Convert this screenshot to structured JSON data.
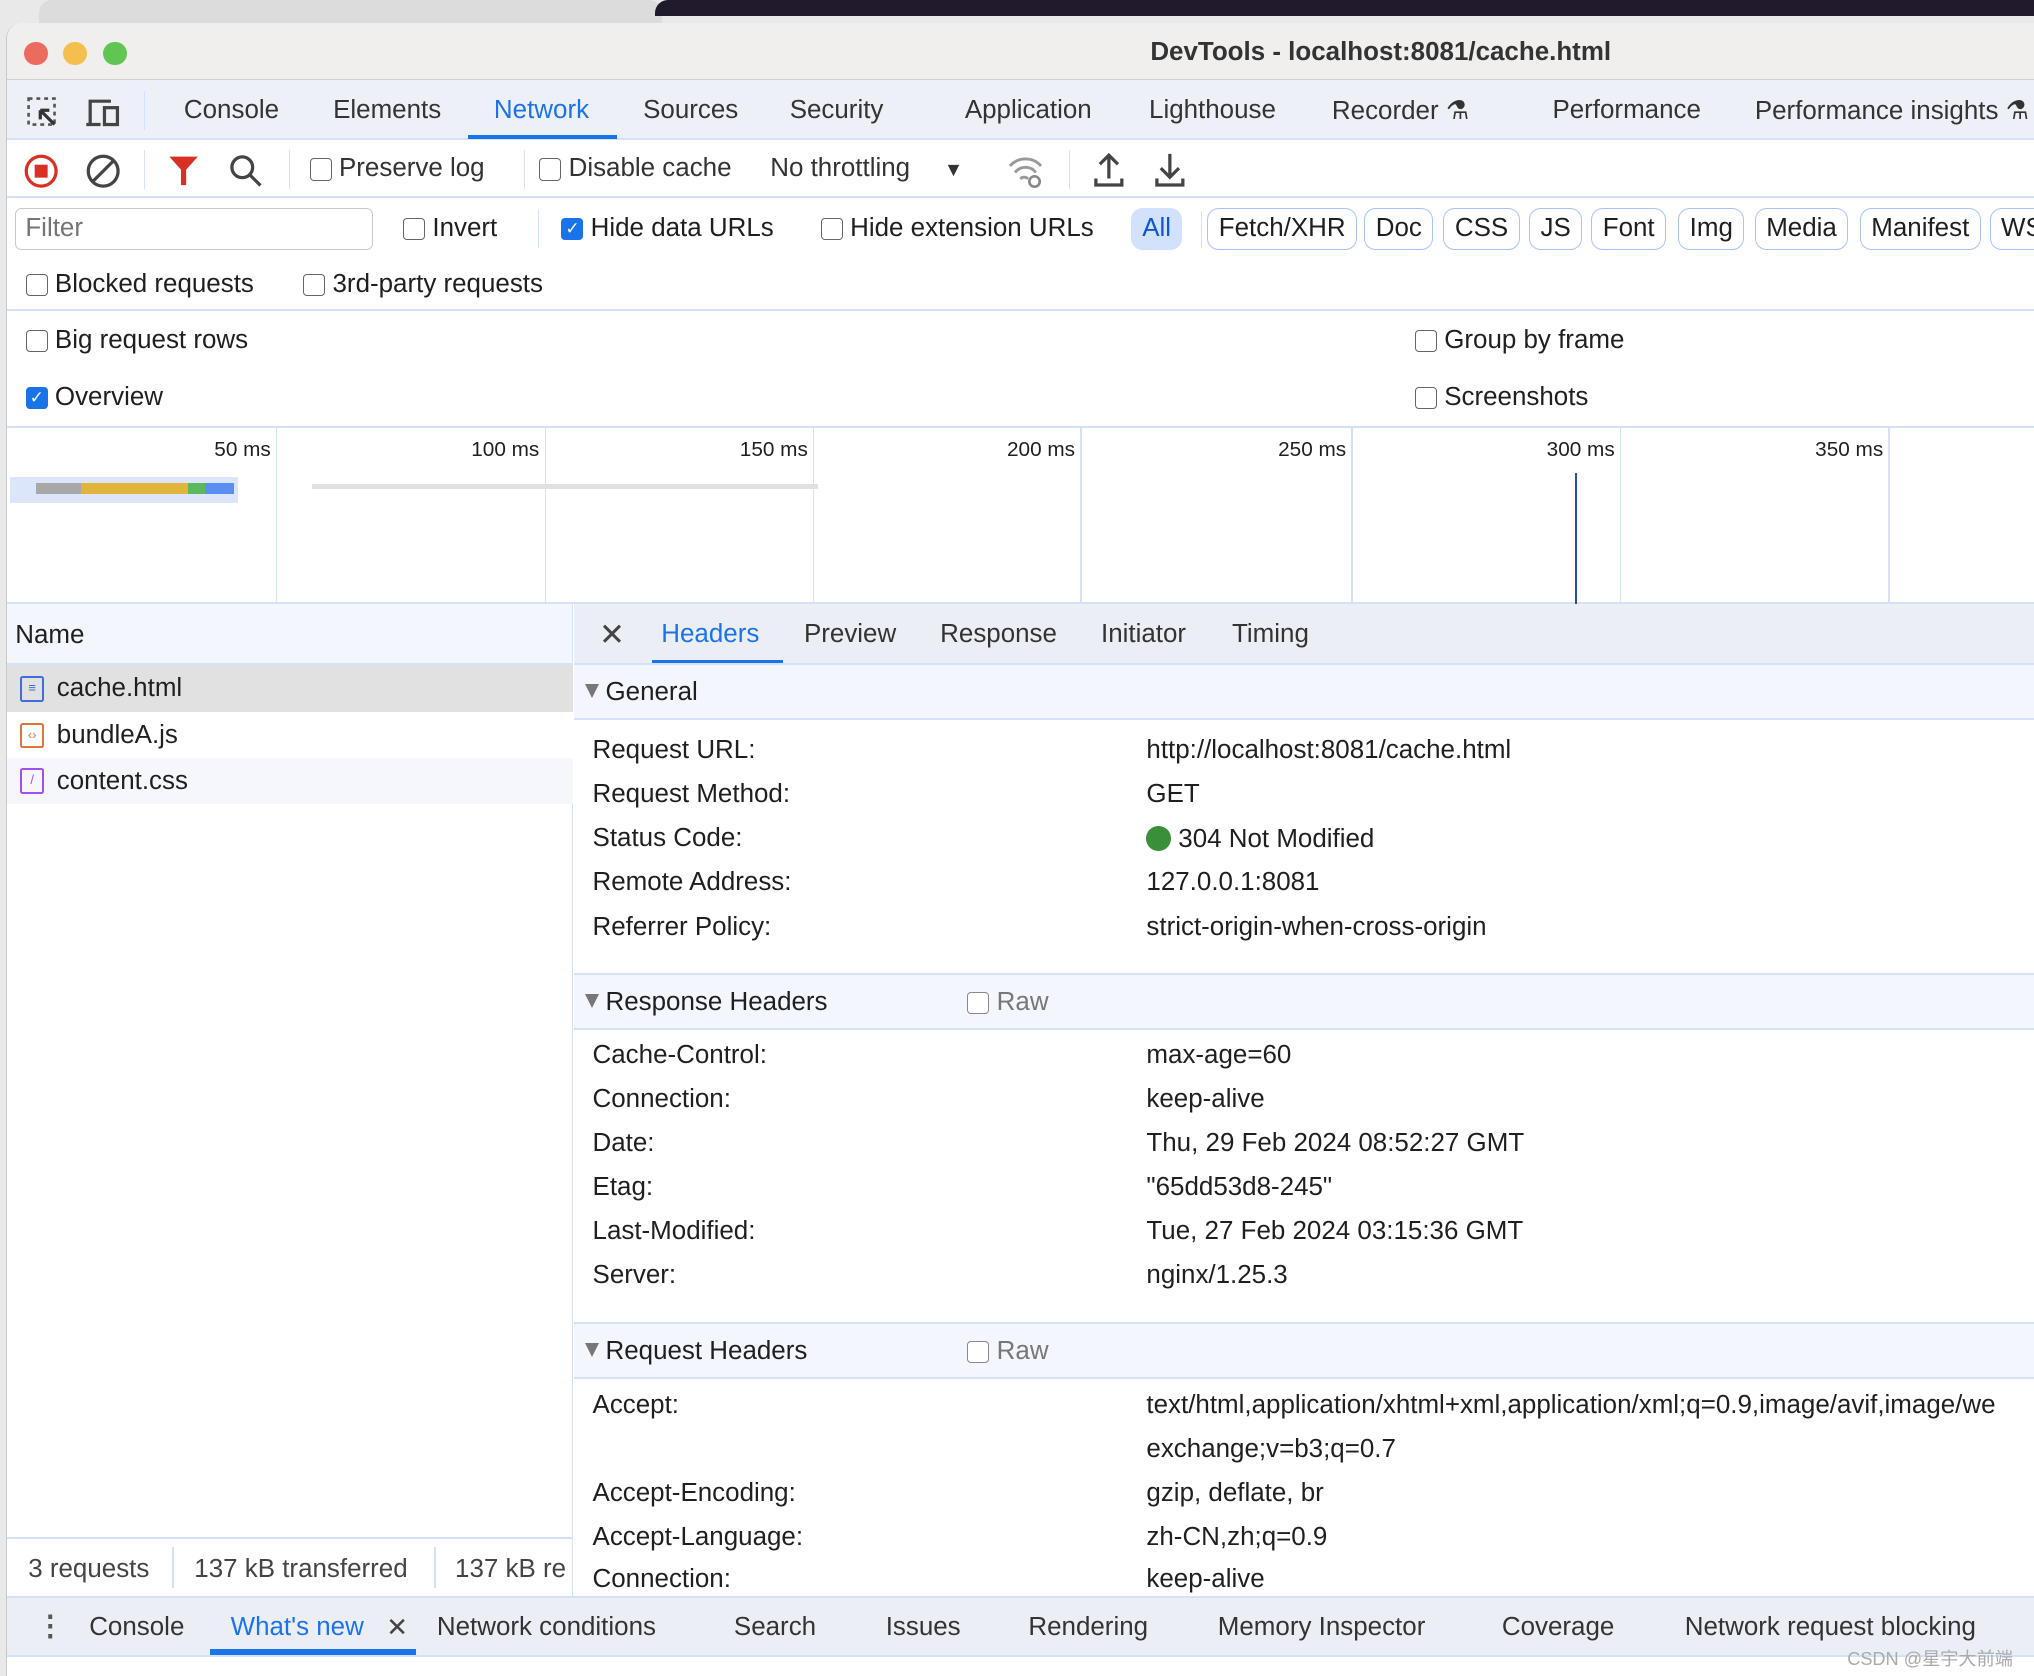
{
  "window": {
    "title": "DevTools - localhost:8081/cache.html"
  },
  "main_tabs": [
    {
      "label": "Console"
    },
    {
      "label": "Elements"
    },
    {
      "label": "Network",
      "active": true
    },
    {
      "label": "Sources"
    },
    {
      "label": "Security"
    },
    {
      "label": "Application"
    },
    {
      "label": "Lighthouse"
    },
    {
      "label": "Recorder"
    },
    {
      "label": "Performance"
    },
    {
      "label": "Performance insights"
    }
  ],
  "toolbar": {
    "preserve_log": "Preserve log",
    "preserve_log_checked": false,
    "disable_cache": "Disable cache",
    "disable_cache_checked": false,
    "throttling": "No throttling"
  },
  "filter_bar": {
    "filter_placeholder": "Filter",
    "invert": "Invert",
    "hide_data_urls": "Hide data URLs",
    "hide_data_urls_checked": true,
    "hide_extension_urls": "Hide extension URLs",
    "types": [
      "All",
      "Fetch/XHR",
      "Doc",
      "CSS",
      "JS",
      "Font",
      "Img",
      "Media",
      "Manifest",
      "WS"
    ],
    "blocked_requests": "Blocked requests",
    "third_party_requests": "3rd-party requests"
  },
  "settings": {
    "big_request_rows": "Big request rows",
    "overview": "Overview",
    "overview_checked": true,
    "group_by_frame": "Group by frame",
    "screenshots": "Screenshots"
  },
  "overview": {
    "ticks": [
      "50 ms",
      "100 ms",
      "150 ms",
      "200 ms",
      "250 ms",
      "300 ms",
      "350 ms"
    ]
  },
  "requests": {
    "column_name": "Name",
    "items": [
      {
        "name": "cache.html",
        "type": "document"
      },
      {
        "name": "bundleA.js",
        "type": "script"
      },
      {
        "name": "content.css",
        "type": "stylesheet"
      }
    ]
  },
  "status_bar": {
    "requests": "3 requests",
    "transferred": "137 kB transferred",
    "resources": "137 kB re"
  },
  "detail_tabs": [
    "Headers",
    "Preview",
    "Response",
    "Initiator",
    "Timing"
  ],
  "general": {
    "title": "General",
    "rows": [
      {
        "k": "Request URL:",
        "v": "http://localhost:8081/cache.html"
      },
      {
        "k": "Request Method:",
        "v": "GET"
      },
      {
        "k": "Status Code:",
        "v": "304 Not Modified"
      },
      {
        "k": "Remote Address:",
        "v": "127.0.0.1:8081"
      },
      {
        "k": "Referrer Policy:",
        "v": "strict-origin-when-cross-origin"
      }
    ],
    "status_color": "#3a8f3a"
  },
  "response_headers": {
    "title": "Response Headers",
    "raw": "Raw",
    "rows": [
      {
        "k": "Cache-Control:",
        "v": "max-age=60"
      },
      {
        "k": "Connection:",
        "v": "keep-alive"
      },
      {
        "k": "Date:",
        "v": "Thu, 29 Feb 2024 08:52:27 GMT"
      },
      {
        "k": "Etag:",
        "v": "\"65dd53d8-245\""
      },
      {
        "k": "Last-Modified:",
        "v": "Tue, 27 Feb 2024 03:15:36 GMT"
      },
      {
        "k": "Server:",
        "v": "nginx/1.25.3"
      }
    ]
  },
  "request_headers": {
    "title": "Request Headers",
    "raw": "Raw",
    "rows": [
      {
        "k": "Accept:",
        "v": "text/html,application/xhtml+xml,application/xml;q=0.9,image/avif,image/we",
        "v2": "exchange;v=b3;q=0.7"
      },
      {
        "k": "Accept-Encoding:",
        "v": "gzip, deflate, br"
      },
      {
        "k": "Accept-Language:",
        "v": "zh-CN,zh;q=0.9"
      },
      {
        "k": "Connection:",
        "v": "keep-alive"
      }
    ]
  },
  "drawer_tabs": [
    "Console",
    "What's new",
    "Network conditions",
    "Search",
    "Issues",
    "Rendering",
    "Memory Inspector",
    "Coverage",
    "Network request blocking"
  ],
  "drawer_active": "What's new",
  "watermark": "CSDN @星宇大前端",
  "colors": {
    "accent": "#1a73e8",
    "record": "#d93025"
  }
}
